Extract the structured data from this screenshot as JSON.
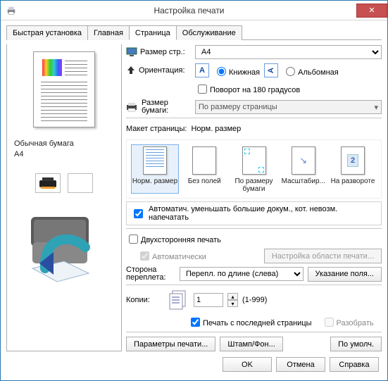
{
  "window": {
    "title": "Настройка печати",
    "close_label": "✕"
  },
  "tabs": [
    {
      "label": "Быстрая установка",
      "active": false
    },
    {
      "label": "Главная",
      "active": false
    },
    {
      "label": "Страница",
      "active": true
    },
    {
      "label": "Обслуживание",
      "active": false
    }
  ],
  "left": {
    "paper_line1": "Обычная бумага",
    "paper_line2": "A4"
  },
  "right": {
    "page_size_label": "Размер стр.:",
    "page_size_value": "A4",
    "orientation_label": "Ориентация:",
    "orient_book": "Книжная",
    "orient_album": "Альбомная",
    "rotate180": "Поворот на 180 градусов",
    "printer_paper_label_l1": "Размер",
    "printer_paper_label_l2": "бумаги:",
    "printer_paper_value": "По размеру страницы",
    "layout_label": "Макет страницы:",
    "layout_value": "Норм. размер",
    "opts": [
      {
        "label": "Норм. размер"
      },
      {
        "label": "Без полей"
      },
      {
        "label": "По размеру бумаги"
      },
      {
        "label": "Масштабир..."
      },
      {
        "label": "На развороте"
      }
    ],
    "autoshrink": "Автоматич. уменьшать большие докум., кот. невозм. напечатать",
    "duplex_label": "Двухсторонняя печать",
    "duplex_auto": "Автоматически",
    "duplex_area_btn": "Настройка области печати...",
    "bind_label_l1": "Сторона",
    "bind_label_l2": "переплета:",
    "bind_value": "Перепл. по длине (слева)",
    "bind_margin_btn": "Указание поля...",
    "copies_label": "Копии:",
    "copies_value": "1",
    "copies_range": "(1-999)",
    "copies_lastpage": "Печать с последней страницы",
    "copies_collate": "Разобрать",
    "btn_params": "Параметры печати...",
    "btn_stamp": "Штамп/Фон...",
    "btn_defaults": "По умолч."
  },
  "footer": {
    "ok": "OK",
    "cancel": "Отмена",
    "help": "Справка"
  }
}
